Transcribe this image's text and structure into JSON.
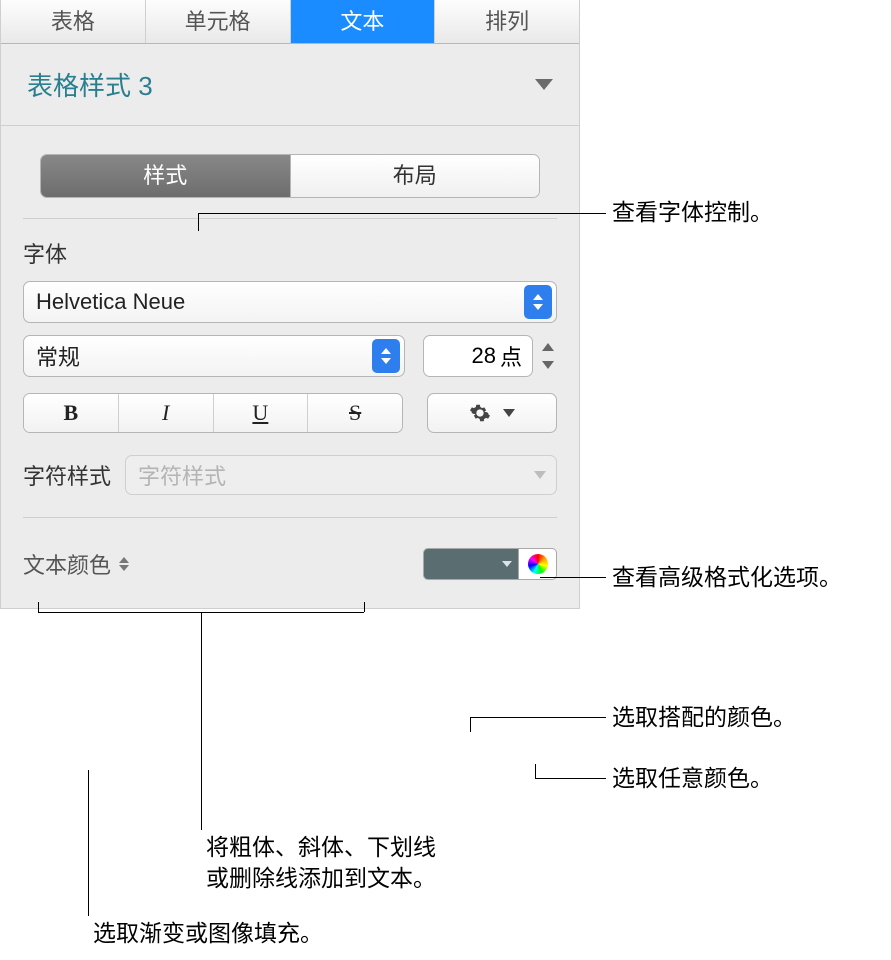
{
  "tabs": {
    "table": "表格",
    "cell": "单元格",
    "text": "文本",
    "arrange": "排列"
  },
  "styleName": "表格样式 3",
  "segmented": {
    "style": "样式",
    "layout": "布局"
  },
  "font": {
    "sectionLabel": "字体",
    "family": "Helvetica Neue",
    "weight": "常规",
    "sizeValue": "28",
    "sizeUnit": "点",
    "bold": "B",
    "italic": "I",
    "underline": "U",
    "strike": "S"
  },
  "charStyle": {
    "label": "字符样式",
    "placeholder": "字符样式"
  },
  "textColor": {
    "label": "文本颜色",
    "swatch": "#5a6e72"
  },
  "callouts": {
    "fontControls": "查看字体控制。",
    "advancedFormat": "查看高级格式化选项。",
    "matchColor": "选取搭配的颜色。",
    "anyColor": "选取任意颜色。",
    "bius": "将粗体、斜体、下划线\n或删除线添加到文本。",
    "fill": "选取渐变或图像填充。"
  }
}
